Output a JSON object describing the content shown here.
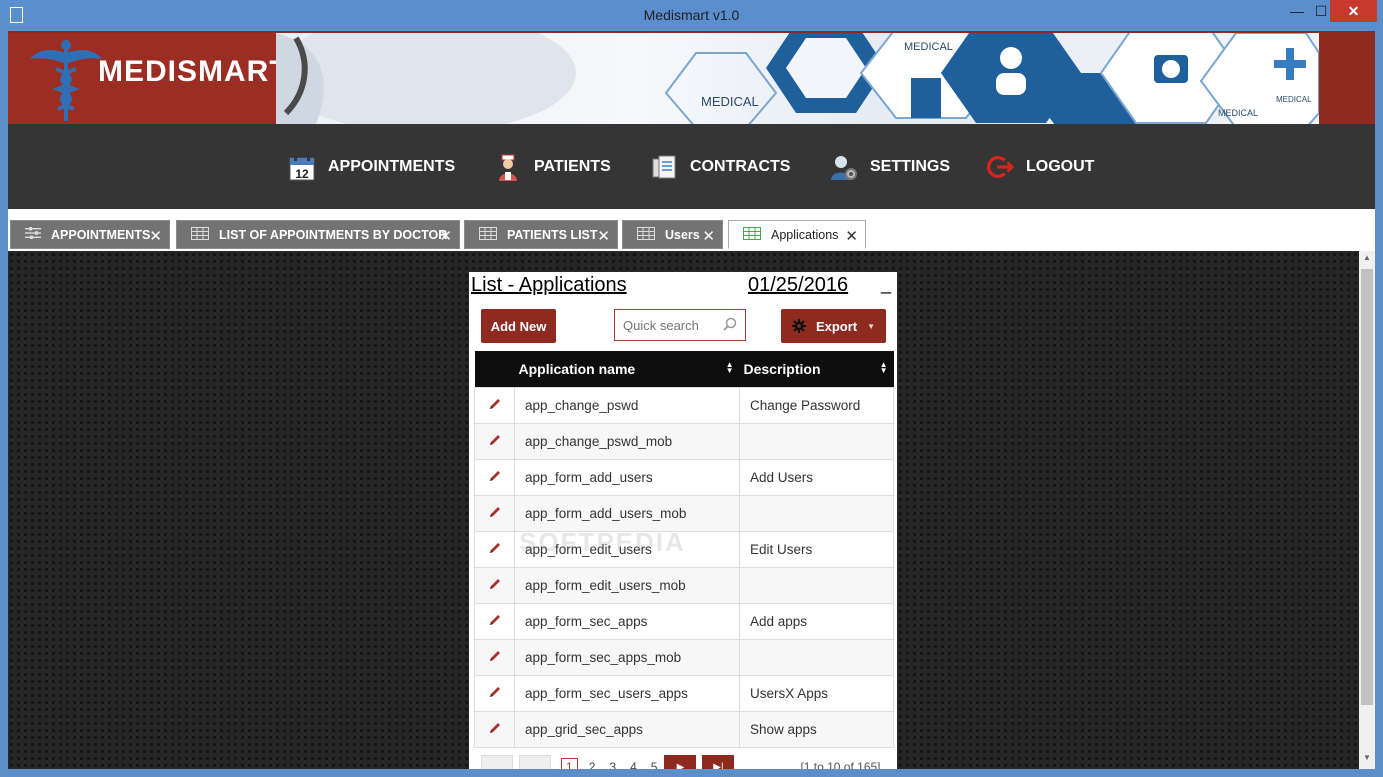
{
  "window": {
    "title": "Medismart v1.0",
    "minimize": "—",
    "maximize": "☐",
    "close": "✕"
  },
  "brand": {
    "name": "MEDISMART",
    "accent": "#8f2a21"
  },
  "banner": {
    "labels": [
      "MEDICAL",
      "MEDICAL",
      "MEDICAL",
      "MEDICAL"
    ]
  },
  "nav": [
    {
      "label": "APPOINTMENTS",
      "icon": "calendar-icon"
    },
    {
      "label": "PATIENTS",
      "icon": "nurse-icon"
    },
    {
      "label": "CONTRACTS",
      "icon": "documents-icon"
    },
    {
      "label": "SETTINGS",
      "icon": "user-gear-icon"
    },
    {
      "label": "LOGOUT",
      "icon": "logout-icon"
    }
  ],
  "tabs": [
    {
      "label": "APPOINTMENTS",
      "icon": "sliders-icon",
      "active": false
    },
    {
      "label": "LIST OF APPOINTMENTS BY DOCTOR",
      "icon": "grid-icon",
      "active": false
    },
    {
      "label": "PATIENTS LIST",
      "icon": "grid-icon",
      "active": false
    },
    {
      "label": "Users",
      "icon": "grid-icon",
      "active": false
    },
    {
      "label": "Applications",
      "icon": "grid-icon",
      "active": true
    }
  ],
  "panel": {
    "title": "List - Applications",
    "date": "01/25/2016",
    "minimize": "_",
    "add_new": "Add New",
    "search_placeholder": "Quick search",
    "export": "Export",
    "columns": [
      "Application name",
      "Description"
    ],
    "rows": [
      {
        "name": "app_change_pswd",
        "description": "Change Password"
      },
      {
        "name": "app_change_pswd_mob",
        "description": ""
      },
      {
        "name": "app_form_add_users",
        "description": "Add Users"
      },
      {
        "name": "app_form_add_users_mob",
        "description": ""
      },
      {
        "name": "app_form_edit_users",
        "description": "Edit Users"
      },
      {
        "name": "app_form_edit_users_mob",
        "description": ""
      },
      {
        "name": "app_form_sec_apps",
        "description": "Add apps"
      },
      {
        "name": "app_form_sec_apps_mob",
        "description": ""
      },
      {
        "name": "app_form_sec_users_apps",
        "description": "UsersX Apps"
      },
      {
        "name": "app_grid_sec_apps",
        "description": "Show apps"
      }
    ],
    "pager": {
      "pages": [
        "1",
        "2",
        "3",
        "4",
        "5"
      ],
      "current": "1",
      "info": "[1 to 10 of 165]"
    },
    "watermark": "SOFTPEDIA"
  }
}
